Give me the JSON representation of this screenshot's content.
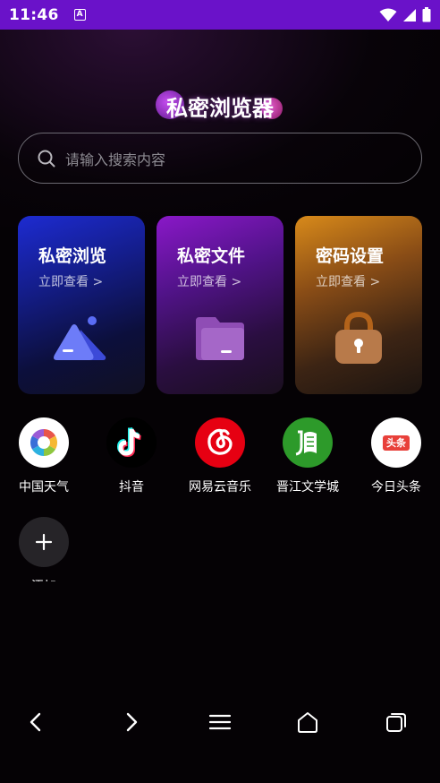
{
  "status_bar": {
    "time": "11:46",
    "notification_badge": "A",
    "background": "#6a12c9"
  },
  "header": {
    "app_title": "私密浏览器"
  },
  "search": {
    "placeholder": "请输入搜索内容"
  },
  "cards": [
    {
      "title": "私密浏览",
      "action": "立即查看 >",
      "icon": "mountain-icon",
      "accent": "#1d2bd1"
    },
    {
      "title": "私密文件",
      "action": "立即查看 >",
      "icon": "folder-icon",
      "accent": "#8a18c8"
    },
    {
      "title": "密码设置",
      "action": "立即查看 >",
      "icon": "lock-icon",
      "accent": "#d88a1a"
    }
  ],
  "shortcuts": [
    {
      "label": "中国天气",
      "icon": "china-weather-icon"
    },
    {
      "label": "抖音",
      "icon": "douyin-icon"
    },
    {
      "label": "网易云音乐",
      "icon": "netease-music-icon"
    },
    {
      "label": "晋江文学城",
      "icon": "jjwxc-icon"
    },
    {
      "label": "今日头条",
      "icon": "toutiao-icon",
      "icon_text": "头条"
    }
  ],
  "add_shortcut": {
    "label": "添加"
  },
  "bottom_nav": [
    {
      "name": "back",
      "icon": "back-arrow-icon"
    },
    {
      "name": "forward",
      "icon": "forward-arrow-icon"
    },
    {
      "name": "menu",
      "icon": "menu-icon"
    },
    {
      "name": "home",
      "icon": "home-icon"
    },
    {
      "name": "tabs",
      "icon": "tabs-icon"
    }
  ]
}
